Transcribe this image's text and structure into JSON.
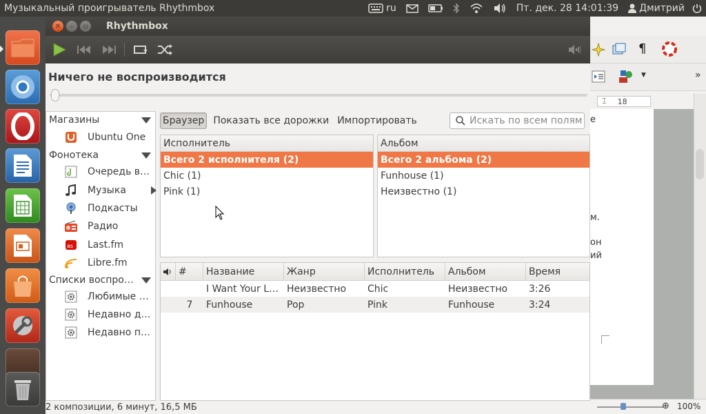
{
  "top_panel": {
    "app_title": "Музыкальный проигрыватель Rhythmbox",
    "keyboard_layout": "ru",
    "datetime": "Пт. дек. 28 14:01:39",
    "user": "Дмитрий"
  },
  "window": {
    "title": "Rhythmbox",
    "now_playing": "Ничего не воспроизводится",
    "status": "2 композиции, 6 минут, 16,5 МБ"
  },
  "sidebar": {
    "categories": [
      {
        "label": "Магазины"
      },
      {
        "label": "Фонотека"
      },
      {
        "label": "Списки воспро…"
      }
    ],
    "items": [
      {
        "label": "Ubuntu One",
        "icon": "ubuntu-one-icon"
      },
      {
        "label": "Очередь в…",
        "icon": "play-queue-icon"
      },
      {
        "label": "Музыка",
        "icon": "music-note-icon"
      },
      {
        "label": "Подкасты",
        "icon": "podcast-icon"
      },
      {
        "label": "Радио",
        "icon": "radio-icon"
      },
      {
        "label": "Last.fm",
        "icon": "lastfm-icon"
      },
      {
        "label": "Libre.fm",
        "icon": "librefm-icon"
      },
      {
        "label": "Любимые …",
        "icon": "playlist-gear-icon"
      },
      {
        "label": "Недавно д…",
        "icon": "playlist-gear-icon"
      },
      {
        "label": "Недавно п…",
        "icon": "playlist-gear-icon"
      }
    ]
  },
  "browse_bar": {
    "browser": "Браузер",
    "show_all": "Показать все дорожки",
    "import": "Импортировать",
    "search_placeholder": "Искать по всем полям"
  },
  "artist_pane": {
    "header": "Исполнитель",
    "rows": [
      "Всего 2 исполнителя (2)",
      "Chic (1)",
      "Pink (1)"
    ]
  },
  "album_pane": {
    "header": "Альбом",
    "rows": [
      "Всего 2 альбома (2)",
      "Funhouse (1)",
      "Неизвестно (1)"
    ]
  },
  "tracks": {
    "columns": [
      "#",
      "Название",
      "Жанр",
      "Исполнитель",
      "Альбом",
      "Время"
    ],
    "rows": [
      {
        "num": "",
        "title": "I Want Your L…",
        "genre": "Неизвестно",
        "artist": "Chic",
        "album": "Неизвестно",
        "time": "3:26"
      },
      {
        "num": "7",
        "title": "Funhouse",
        "genre": "Pop",
        "artist": "Pink",
        "album": "Funhouse",
        "time": "3:24"
      }
    ]
  },
  "background_app": {
    "ruler_mark": "18",
    "zoom": "100%",
    "text_fragments": [
      "е",
      "м.",
      "он",
      "ий"
    ]
  },
  "colors": {
    "accent": "#f07746",
    "panel": "#3c3b37",
    "launcher": "#4a4a48"
  }
}
